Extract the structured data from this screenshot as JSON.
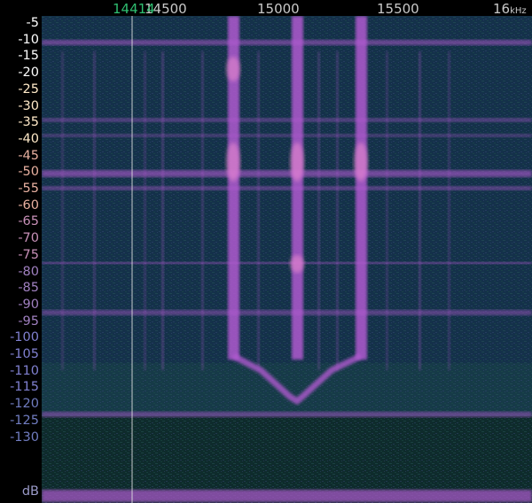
{
  "frequency_axis": {
    "labels": [
      {
        "text": "14500",
        "value": 14500
      },
      {
        "text": "15000",
        "value": 15000
      },
      {
        "text": "15500",
        "value": 15500
      },
      {
        "text": "16",
        "value": 16000
      }
    ],
    "unit_label": "kHz"
  },
  "cursor": {
    "readout": "14414",
    "value": 14414
  },
  "db_axis": {
    "labels": [
      "-5",
      "-10",
      "-15",
      "-20",
      "-25",
      "-30",
      "-35",
      "-40",
      "-45",
      "-50",
      "-55",
      "-60",
      "-65",
      "-70",
      "-75",
      "-80",
      "-85",
      "-90",
      "-95",
      "-100",
      "-105",
      "-110",
      "-115",
      "-120",
      "-125",
      "-130"
    ],
    "unit": "dB"
  },
  "colors": {
    "background": "#14314a",
    "low_band": "#0e2b2c",
    "signal": "#b05ad0",
    "signal_hot": "#f08fd0",
    "cursor_text": "#2fbf71",
    "axis_text": "#c9c9c9",
    "label_gradient": [
      "#ffffff",
      "#ffe9c8",
      "#e8b0a0",
      "#c890b8",
      "#a080c0",
      "#8080d0",
      "#707cc0"
    ]
  }
}
